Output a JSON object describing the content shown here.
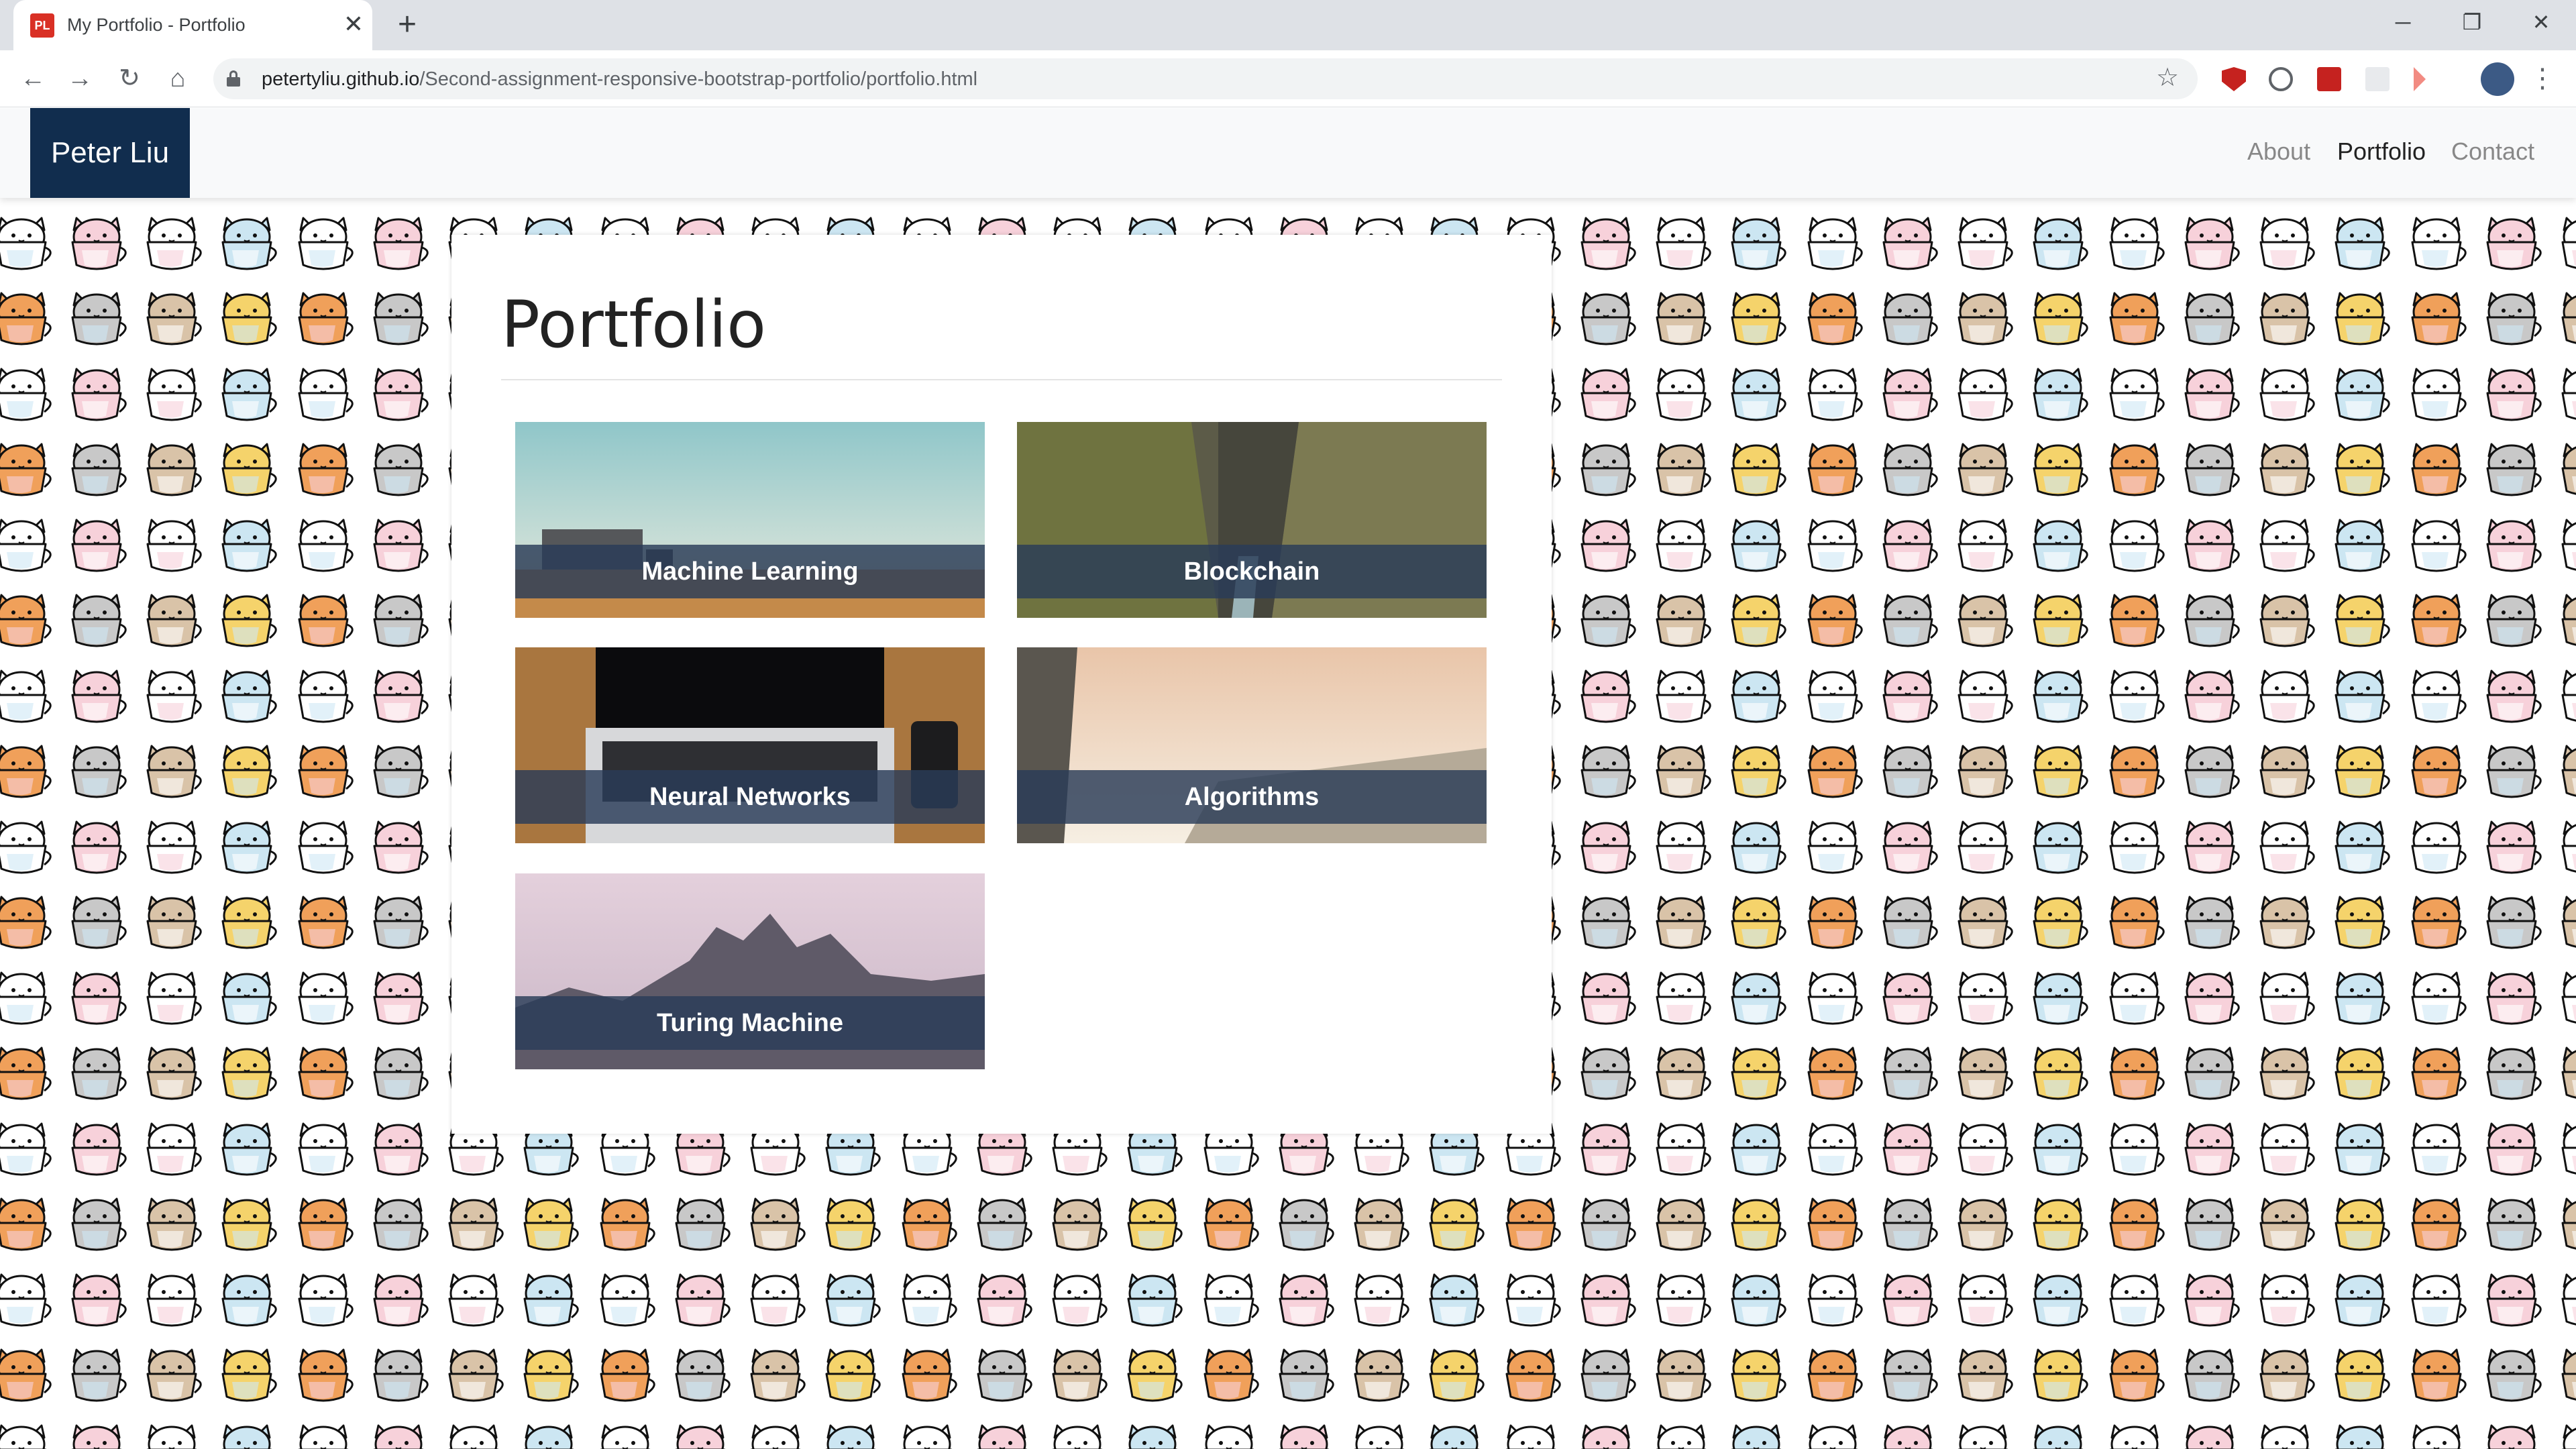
{
  "browser": {
    "tab_title": "My Portfolio - Portfolio",
    "favicon_text": "PL",
    "favicon_color": "#d93025",
    "new_tab_symbol": "+",
    "close_symbol": "✕",
    "url_host": "petertyliu.github.io",
    "url_path": "/Second-assignment-responsive-bootstrap-portfolio/portfolio.html",
    "back_symbol": "←",
    "forward_symbol": "→",
    "reload_symbol": "↻",
    "home_symbol": "⌂",
    "bookmark_symbol": "☆",
    "minimize_symbol": "─",
    "restore_symbol": "❐",
    "window_close_symbol": "✕",
    "menu_symbol": "⋮"
  },
  "site": {
    "brand": "Peter Liu",
    "brand_color": "#112d4e",
    "nav": [
      {
        "label": "About",
        "active": false
      },
      {
        "label": "Portfolio",
        "active": true
      },
      {
        "label": "Contact",
        "active": false
      }
    ]
  },
  "main": {
    "title": "Portfolio",
    "items": [
      {
        "caption": "Machine Learning",
        "image": "field-with-truck"
      },
      {
        "caption": "Blockchain",
        "image": "canyon-river"
      },
      {
        "caption": "Neural Networks",
        "image": "laptop-on-desk"
      },
      {
        "caption": "Algorithms",
        "image": "misty-cliffs"
      },
      {
        "caption": "Turing Machine",
        "image": "mountain-peaks"
      }
    ]
  }
}
